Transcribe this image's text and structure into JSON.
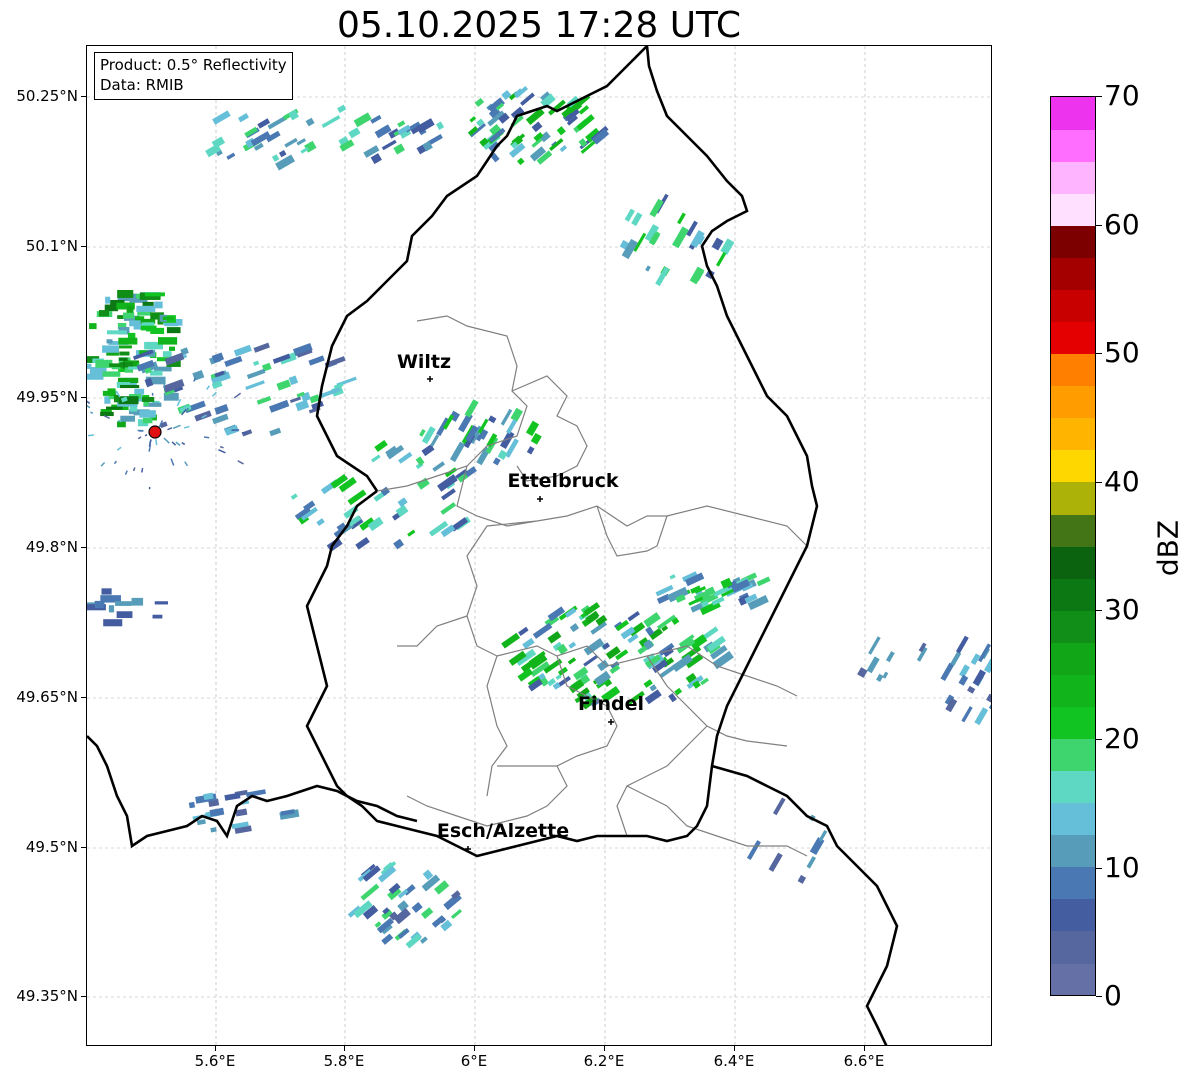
{
  "title": "05.10.2025 17:28 UTC",
  "info": {
    "product": "Product: 0.5° Reflectivity",
    "data": "Data: RMIB"
  },
  "y_ticks": [
    "50.25°N",
    "50.1°N",
    "49.95°N",
    "49.8°N",
    "49.65°N",
    "49.5°N",
    "49.35°N"
  ],
  "x_ticks": [
    "5.6°E",
    "5.8°E",
    "6°E",
    "6.2°E",
    "6.4°E",
    "6.6°E"
  ],
  "cities": [
    {
      "name": "Wiltz"
    },
    {
      "name": "Ettelbruck"
    },
    {
      "name": "Findel"
    },
    {
      "name": "Esch/Alzette"
    }
  ],
  "colorbar": {
    "label": "dBZ",
    "ticks": [
      "0",
      "10",
      "20",
      "30",
      "40",
      "50",
      "60",
      "70"
    ],
    "range": [
      0,
      70
    ],
    "step": 2.5,
    "colors": [
      "#6570a6",
      "#55679e",
      "#435da0",
      "#4a78b2",
      "#579db9",
      "#66bfd8",
      "#5ed8c2",
      "#3ed56f",
      "#12c421",
      "#12b41b",
      "#11a617",
      "#108e17",
      "#0c7813",
      "#0b620f",
      "#437516",
      "#acb208",
      "#ffd700",
      "#ffb400",
      "#ff9c00",
      "#ff7f00",
      "#e40000",
      "#c80000",
      "#a50000",
      "#7c0000",
      "#ffe0ff",
      "#ffb4ff",
      "#ff6eff",
      "#ee33ee"
    ]
  },
  "radar_site": {
    "color": "#e01010"
  },
  "map_colors": {
    "country_border": "#000000",
    "canton_border": "#808080",
    "grid": "#b0b0b0"
  }
}
